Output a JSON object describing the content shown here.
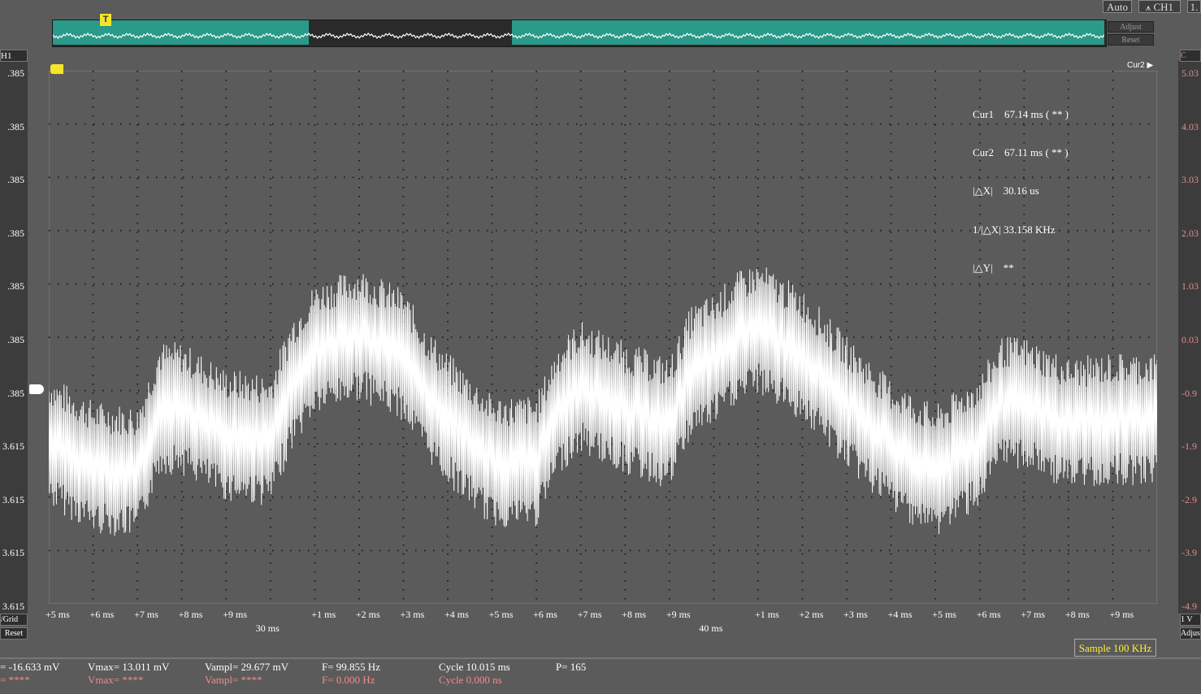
{
  "toolbar": {
    "auto_label": "Auto",
    "ch1_label": "CH1",
    "extra_label": "1."
  },
  "overview": {
    "adjust_label": "Adjust",
    "reset_label": "Reset",
    "trigger_marker": "T"
  },
  "left_axis": {
    "channel_label": "H1",
    "ticks": [
      ".385",
      ".385",
      ".385",
      ".385",
      ".385",
      ".385",
      ".385",
      "3.615",
      "3.615",
      "3.615",
      "3.615"
    ],
    "vgrid_label": "/Grid",
    "reset_label": "Reset"
  },
  "right_axis": {
    "channel_label": "C",
    "ticks": [
      "5.03",
      "4.03",
      "3.03",
      "2.03",
      "1.03",
      "0.03",
      "-0.9",
      "-1.9",
      "-2.9",
      "-3.9",
      "-4.9"
    ],
    "scale_label": "1 V",
    "adjust_label": "Adjus"
  },
  "cursor_labels": {
    "cur2_tag": "Cur2"
  },
  "cursor_info": {
    "cur1": "Cur1    67.14 ms ( ** )",
    "cur2": "Cur2    67.11 ms ( ** )",
    "dx": "|△X|    30.16 us",
    "inv_dx": "1/|△X| 33.158 KHz",
    "dy": "|△Y|    **"
  },
  "x_axis": {
    "ticks": [
      "+5 ms",
      "+6 ms",
      "+7 ms",
      "+8 ms",
      "+9 ms",
      "",
      "+1 ms",
      "+2 ms",
      "+3 ms",
      "+4 ms",
      "+5 ms",
      "+6 ms",
      "+7 ms",
      "+8 ms",
      "+9 ms",
      "",
      "+1 ms",
      "+2 ms",
      "+3 ms",
      "+4 ms",
      "+5 ms",
      "+6 ms",
      "+7 ms",
      "+8 ms",
      "+9 ms"
    ],
    "major_labels": [
      "30 ms",
      "40 ms"
    ]
  },
  "sample_label": "Sample 100 KHz",
  "measurements": {
    "row1": {
      "vmin": "= -16.633 mV",
      "vmax": "Vmax= 13.011 mV",
      "vampl": "Vampl= 29.677 mV",
      "freq": "F= 99.855 Hz",
      "cycle": "Cycle 10.015 ms",
      "p": "P= 165"
    },
    "row2": {
      "vmin": "= ****",
      "vmax": "Vmax= ****",
      "vampl": "Vampl= ****",
      "freq": "F= 0.000 Hz",
      "cycle": "Cycle 0.000 ns"
    }
  },
  "colors": {
    "background": "#5b5b5b",
    "trace": "#ffffff",
    "overview_fill": "#2a9a8a",
    "marker": "#f5e52a",
    "secondary_text": "#f08c8c"
  },
  "chart_data": {
    "type": "line",
    "title": "",
    "xlabel": "",
    "ylabel": "",
    "x_range_ms": [
      24.5,
      49.5
    ],
    "ylim": [
      -4.97,
      5.03
    ],
    "grid": true,
    "series": [
      {
        "x_ms": [
          24.5,
          25.5,
          26.5,
          27.0,
          27.5,
          28.5,
          29.5,
          30.0,
          30.5,
          31.5,
          32.5,
          33.0,
          33.5,
          34.5,
          35.5,
          36.0,
          36.5,
          37.5,
          38.5,
          39.0,
          39.5,
          40.0,
          40.5,
          41.5,
          42.5,
          43.0,
          43.5,
          44.5,
          45.5,
          46.0,
          46.5,
          47.5,
          48.5,
          49.5
        ],
        "values": [
          -1.9,
          -2.4,
          -2.5,
          -1.3,
          -1.3,
          -1.8,
          -1.9,
          -0.8,
          -0.2,
          0.1,
          -0.3,
          -1.0,
          -1.5,
          -2.3,
          -2.3,
          -1.3,
          -0.9,
          -1.3,
          -1.6,
          -0.6,
          -0.4,
          0.0,
          0.2,
          -0.3,
          -1.2,
          -1.6,
          -2.0,
          -2.5,
          -1.9,
          -1.2,
          -1.2,
          -1.6,
          -1.5,
          -1.5
        ]
      }
    ]
  }
}
